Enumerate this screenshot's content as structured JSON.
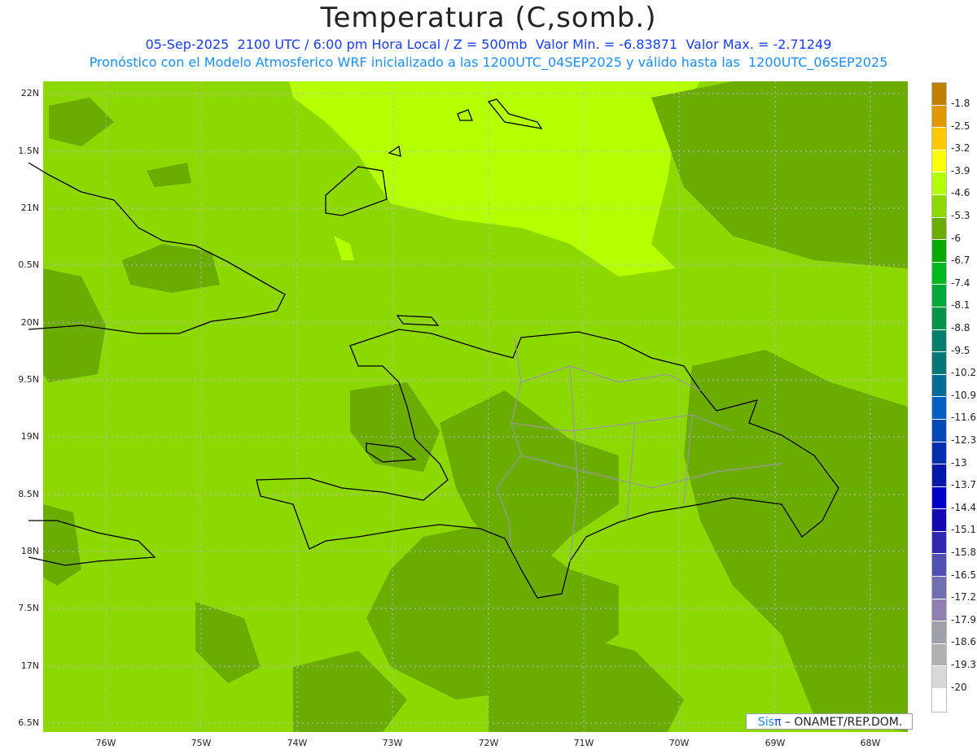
{
  "header": {
    "title": "Temperatura (C,somb.)",
    "line1": "05-Sep-2025  2100 UTC / 6:00 pm Hora Local / Z = 500mb  Valor Min. = -6.83871  Valor Max. = -2.71249",
    "line2": "Pronóstico con el Modelo Atmosferico WRF inicializado a las 1200UTC_04SEP2025 y válido hasta las  1200UTC_06SEP2025"
  },
  "axes": {
    "lat_labels": [
      "22N",
      "1.5N",
      "21N",
      "0.5N",
      "20N",
      "9.5N",
      "19N",
      "8.5N",
      "18N",
      "7.5N",
      "17N",
      "6.5N"
    ],
    "lon_labels": [
      "76W",
      "75W",
      "74W",
      "73W",
      "72W",
      "71W",
      "70W",
      "69W",
      "68W"
    ]
  },
  "colorbar": {
    "labels": [
      "-1.8",
      "-2.5",
      "-3.2",
      "-3.9",
      "-4.6",
      "-5.3",
      "-6",
      "-6.7",
      "-7.4",
      "-8.1",
      "-8.8",
      "-9.5",
      "-10.2",
      "-10.9",
      "-11.6",
      "-12.3",
      "-13",
      "-13.7",
      "-14.4",
      "-15.1",
      "-15.8",
      "-16.5",
      "-17.2",
      "-17.9",
      "-18.6",
      "-19.3",
      "-20"
    ],
    "colors": [
      "#c08000",
      "#e09800",
      "#ffc800",
      "#ffff00",
      "#b4ff00",
      "#8cd800",
      "#6aac00",
      "#08aa00",
      "#00b820",
      "#00a83c",
      "#009448",
      "#00806c",
      "#007878",
      "#006c98",
      "#0060c0",
      "#0048b8",
      "#0030b0",
      "#0018a8",
      "#0000c8",
      "#1408b0",
      "#3028b0",
      "#5050b0",
      "#7070b0",
      "#9080b0",
      "#a0a0a8",
      "#b0b0b0",
      "#d8d8d8",
      "#ffffff"
    ]
  },
  "credit": {
    "sis": "Sis",
    "pi": "π",
    "org": " – ONAMET/REP.DOM."
  }
}
